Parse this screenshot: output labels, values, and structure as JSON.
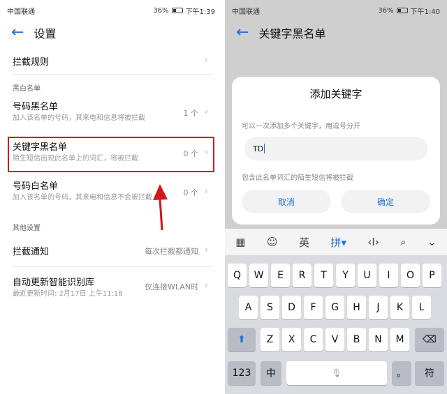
{
  "left": {
    "status": {
      "carrier": "中国联通",
      "battery": "36%",
      "time": "下午1:39"
    },
    "header": {
      "title": "设置"
    },
    "rows": [
      {
        "title": "拦截规则"
      },
      {
        "section": "黑白名单"
      },
      {
        "title": "号码黑名单",
        "subtitle": "加入该名单的号码，其来电和信息将被拦截",
        "value": "1 个"
      },
      {
        "title": "关键字黑名单",
        "subtitle": "陌生短信出现此名单上的词汇，将被拦截",
        "value": "0 个"
      },
      {
        "title": "号码白名单",
        "subtitle": "加入该名单的号码，其来电和信息不会被拦截",
        "value": "0 个"
      },
      {
        "section": "其他设置"
      },
      {
        "title": "拦截通知",
        "value": "每次拦截都通知"
      },
      {
        "title": "自动更新智能识别库",
        "subtitle": "最近更新时间: 2月17日 上午11:18",
        "value": "仅连接WLAN时"
      }
    ]
  },
  "right": {
    "status": {
      "carrier": "中国联通",
      "battery": "36%",
      "time": "下午1:40"
    },
    "header": {
      "title": "关键字黑名单"
    },
    "dialog": {
      "title": "添加关键字",
      "hint": "可以一次添加多个关键字，用逗号分开",
      "input_value": "TD",
      "note": "包含此名单词汇的陌生短信将被拦截",
      "cancel": "取消",
      "confirm": "确定"
    },
    "toolbar": {
      "english": "英",
      "pinyin": "拼"
    },
    "keys": {
      "row1": [
        "Q",
        "W",
        "E",
        "R",
        "T",
        "Y",
        "U",
        "I",
        "O",
        "P"
      ],
      "row2": [
        "A",
        "S",
        "D",
        "F",
        "G",
        "H",
        "J",
        "K",
        "L"
      ],
      "row3": [
        "Z",
        "X",
        "C",
        "V",
        "B",
        "N",
        "M"
      ],
      "numbers": "123",
      "zh": "中",
      "dot": "。",
      "symbols": "符"
    }
  },
  "colors": {
    "accent": "#1e6fd9",
    "highlight": "#d4161d"
  }
}
